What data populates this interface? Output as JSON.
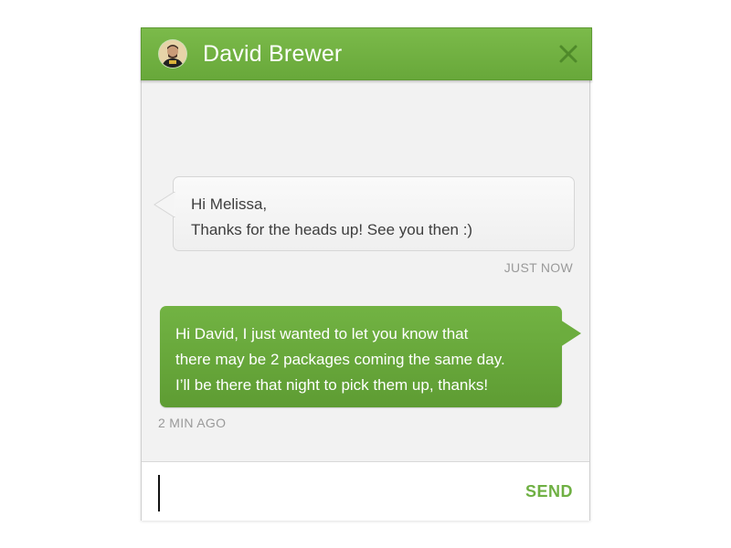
{
  "header": {
    "contact_name": "David Brewer",
    "avatar_icon": "user-avatar",
    "close_icon": "close-icon",
    "accent_color": "#6fae3f"
  },
  "messages": [
    {
      "direction": "incoming",
      "text": "Hi Melissa,\nThanks for the heads up! See you then :)",
      "timestamp": "JUST NOW"
    },
    {
      "direction": "outgoing",
      "text": "Hi David, I just wanted to let you know that\nthere may be 2 packages coming the same day.\nI’ll be there that night to pick them up, thanks!",
      "timestamp": "2 MIN AGO"
    }
  ],
  "composer": {
    "value": "",
    "placeholder": "",
    "send_label": "SEND"
  }
}
